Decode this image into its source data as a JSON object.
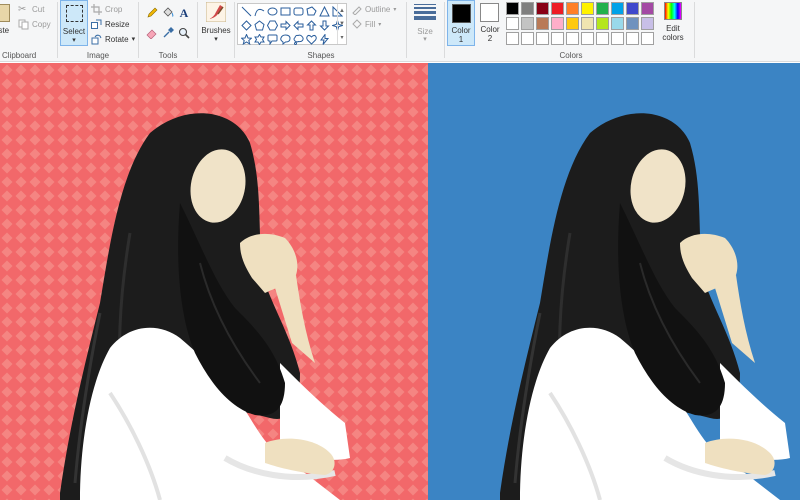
{
  "ribbon": {
    "clipboard": {
      "paste_label": "aste",
      "cut_label": "Cut",
      "copy_label": "Copy",
      "group_label": "Clipboard"
    },
    "image": {
      "select_label": "Select",
      "crop_label": "Crop",
      "resize_label": "Resize",
      "rotate_label": "Rotate",
      "group_label": "Image"
    },
    "tools": {
      "text_glyph": "A",
      "group_label": "Tools"
    },
    "brushes": {
      "label": "Brushes"
    },
    "shapes": {
      "outline_label": "Outline",
      "fill_label": "Fill",
      "group_label": "Shapes",
      "icons": [
        "line-icon",
        "curve-icon",
        "oval-icon",
        "rectangle-icon",
        "rounded-rectangle-icon",
        "polygon-icon",
        "triangle-icon",
        "right-triangle-icon",
        "diamond-icon",
        "pentagon-icon",
        "hexagon-icon",
        "right-arrow-icon",
        "left-arrow-icon",
        "up-arrow-icon",
        "down-arrow-icon",
        "four-point-star-icon",
        "five-point-star-icon",
        "six-point-star-icon",
        "rounded-callout-icon",
        "oval-callout-icon",
        "cloud-callout-icon",
        "heart-icon",
        "lightning-icon"
      ]
    },
    "size": {
      "label": "Size"
    },
    "colors": {
      "color1_label": "Color\n1",
      "color2_label": "Color\n2",
      "color1_value": "#000000",
      "color2_value": "#ffffff",
      "edit_label": "Edit\ncolors",
      "group_label": "Colors",
      "palette_row1": [
        "#000000",
        "#7f7f7f",
        "#880015",
        "#ed1c24",
        "#ff7f27",
        "#fff200",
        "#22b14c",
        "#00a2e8",
        "#3f48cc",
        "#a349a4"
      ],
      "palette_row2": [
        "#ffffff",
        "#c3c3c3",
        "#b97a57",
        "#ffaec9",
        "#ffc90e",
        "#efe4b0",
        "#b5e61d",
        "#99d9ea",
        "#7092be",
        "#c8bfe7"
      ],
      "palette_row3": [
        "#ffffff",
        "#ffffff",
        "#ffffff",
        "#ffffff",
        "#ffffff",
        "#ffffff",
        "#ffffff",
        "#ffffff",
        "#ffffff",
        "#ffffff"
      ]
    }
  },
  "canvas": {
    "left_bg": "#f2686a",
    "right_bg": "#3b84c4",
    "hijab_color": "#1c1c1c",
    "face_color": "#f0e3c8",
    "shirt_color": "#ffffff",
    "skin_color": "#efe0c0"
  }
}
